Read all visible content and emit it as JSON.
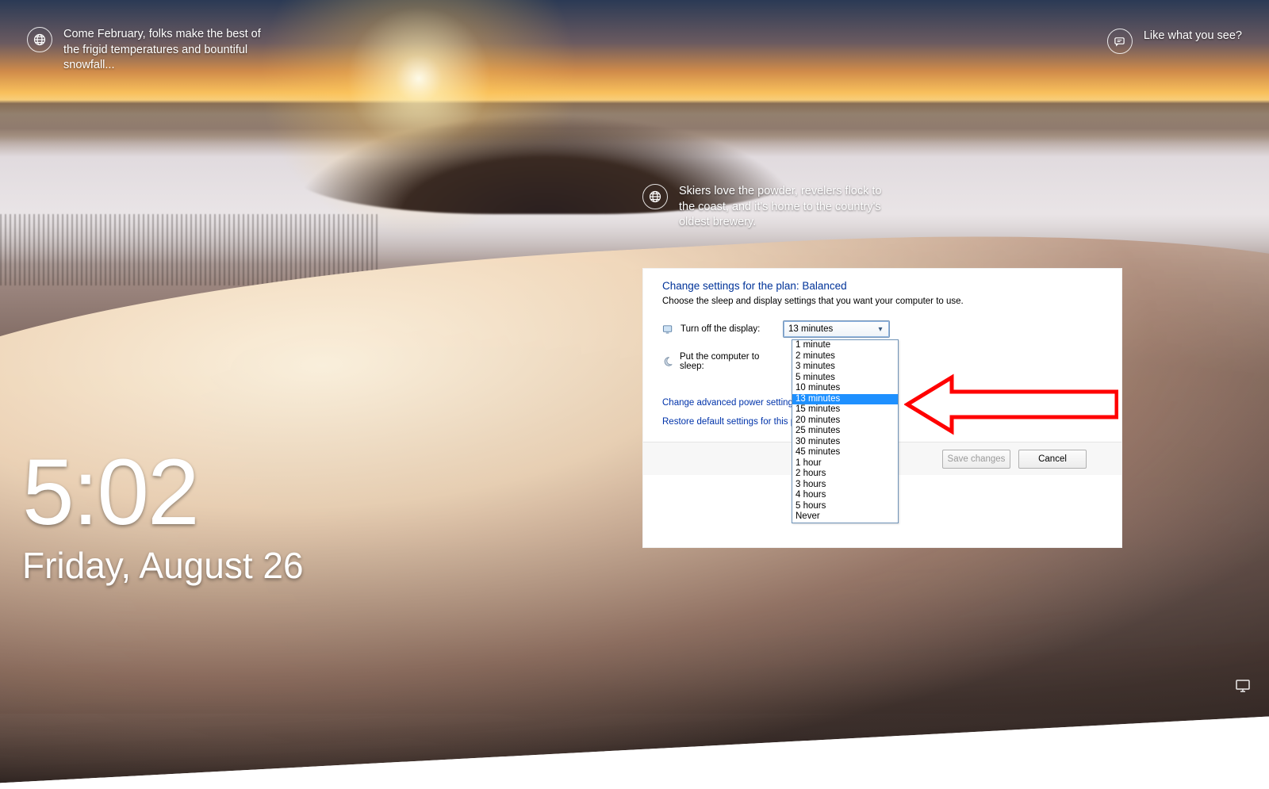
{
  "lockscreen": {
    "tip_top_left": "Come February, folks make the best of the frigid temperatures and bountiful snowfall...",
    "tip_middle": "Skiers love the powder, revelers flock to the coast, and it's home to the country's oldest brewery.",
    "tip_top_right": "Like what you see?",
    "time": "5:02",
    "date": "Friday, August 26"
  },
  "panel": {
    "title": "Change settings for the plan: Balanced",
    "subtitle": "Choose the sleep and display settings that you want your computer to use.",
    "turn_off_display_label": "Turn off the display:",
    "turn_off_display_value": "13 minutes",
    "sleep_label": "Put the computer to sleep:",
    "link_advanced": "Change advanced power settings",
    "link_restore": "Restore default settings for this plan",
    "btn_save": "Save changes",
    "btn_cancel": "Cancel",
    "dropdown_options": [
      "1 minute",
      "2 minutes",
      "3 minutes",
      "5 minutes",
      "10 minutes",
      "13 minutes",
      "15 minutes",
      "20 minutes",
      "25 minutes",
      "30 minutes",
      "45 minutes",
      "1 hour",
      "2 hours",
      "3 hours",
      "4 hours",
      "5 hours",
      "Never"
    ],
    "dropdown_selected_index": 5
  }
}
